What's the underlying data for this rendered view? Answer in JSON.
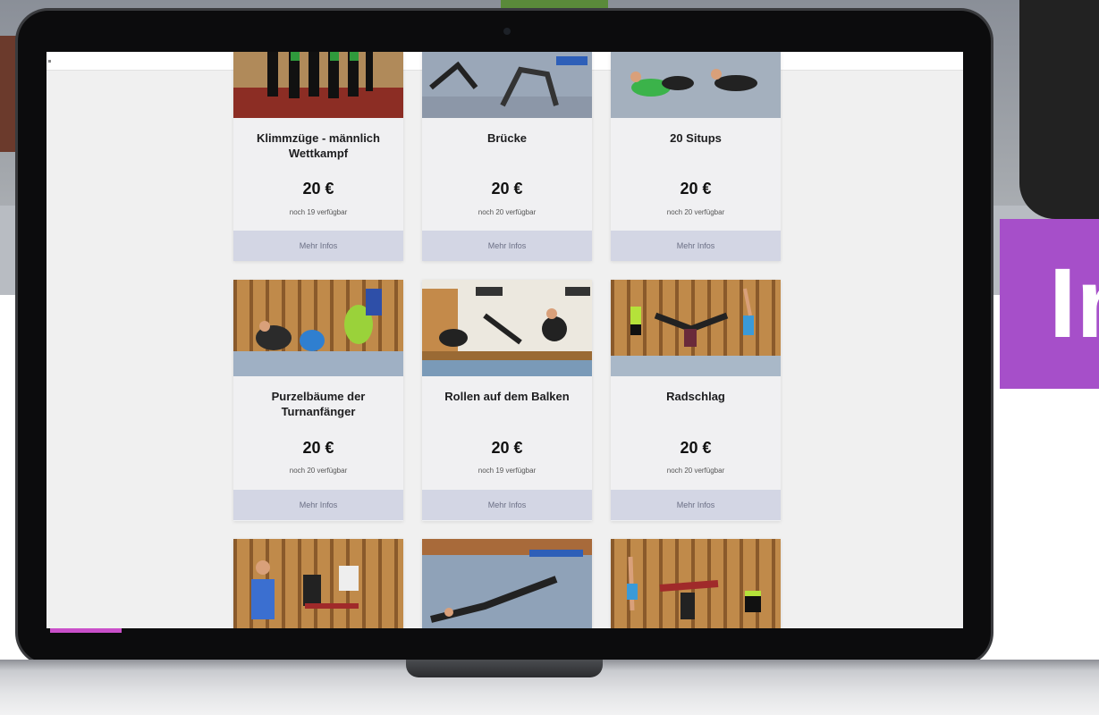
{
  "banner": {
    "text": "In"
  },
  "cards": [
    {
      "title": "Klimmzüge - männlich Wettkampf",
      "price": "20 €",
      "availability": "noch 19 verfügbar",
      "button": "Mehr Infos"
    },
    {
      "title": "Brücke",
      "price": "20 €",
      "availability": "noch 20 verfügbar",
      "button": "Mehr Infos"
    },
    {
      "title": "20 Situps",
      "price": "20 €",
      "availability": "noch 20 verfügbar",
      "button": "Mehr Infos"
    },
    {
      "title": "Purzelbäume der Turnanfänger",
      "price": "20 €",
      "availability": "noch 20 verfügbar",
      "button": "Mehr Infos"
    },
    {
      "title": "Rollen auf dem Balken",
      "price": "20 €",
      "availability": "noch 19 verfügbar",
      "button": "Mehr Infos"
    },
    {
      "title": "Radschlag",
      "price": "20 €",
      "availability": "noch 20 verfügbar",
      "button": "Mehr Infos"
    }
  ],
  "colors": {
    "accent_banner": "#a64fc9",
    "button_bg": "#d3d6e4",
    "button_text": "#6b6f85",
    "page_bg": "#f0f0f0"
  }
}
